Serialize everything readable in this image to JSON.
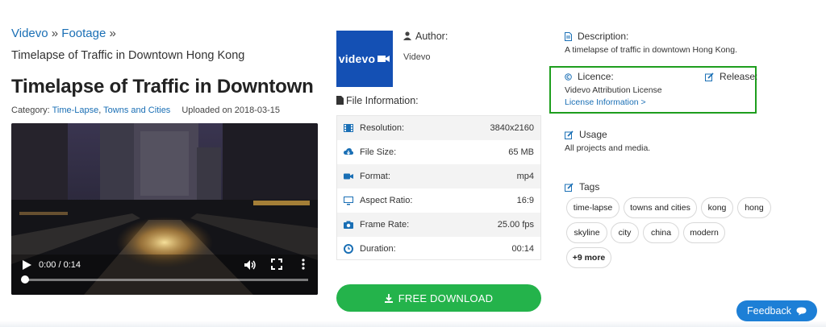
{
  "breadcrumb": {
    "home": "Videvo",
    "sep1": " » ",
    "section": "Footage",
    "sep2": " »"
  },
  "page": {
    "subtitle": "Timelapse of Traffic in Downtown Hong Kong",
    "title": "Timelapse of Traffic in Downtown",
    "category_label": "Category: ",
    "category_1": "Time-Lapse",
    "category_sep": ", ",
    "category_2": "Towns and Cities",
    "uploaded": "Uploaded on 2018-03-15"
  },
  "video": {
    "time": "0:00 / 0:14",
    "progress": 0
  },
  "author": {
    "logo_text": "videvo",
    "label": "Author:",
    "name": "Videvo"
  },
  "file_info": {
    "heading": "File Information:",
    "rows": [
      {
        "icon": "film-icon",
        "label": "Resolution:",
        "value": "3840x2160"
      },
      {
        "icon": "cloud-download-icon",
        "label": "File Size:",
        "value": "65 MB"
      },
      {
        "icon": "video-camera-icon",
        "label": "Format:",
        "value": "mp4"
      },
      {
        "icon": "monitor-icon",
        "label": "Aspect Ratio:",
        "value": "16:9"
      },
      {
        "icon": "camera-icon",
        "label": "Frame Rate:",
        "value": "25.00 fps"
      },
      {
        "icon": "clock-icon",
        "label": "Duration:",
        "value": "00:14"
      }
    ]
  },
  "download": {
    "label": "FREE DOWNLOAD"
  },
  "description": {
    "heading": "Description:",
    "text": "A timelapse of traffic in downtown Hong Kong."
  },
  "licence": {
    "heading": "Licence:",
    "text": "Videvo Attribution License",
    "link": "License Information >",
    "release": "Release:"
  },
  "usage": {
    "heading": "Usage",
    "text": "All projects and media."
  },
  "tags": {
    "heading": "Tags",
    "items": [
      "time-lapse",
      "towns and cities",
      "kong",
      "hong",
      "skyline",
      "city",
      "china",
      "modern"
    ],
    "more": "+9 more"
  },
  "feedback": {
    "label": "Feedback"
  },
  "colors": {
    "link": "#1a6fb5",
    "download": "#24b34b",
    "logo": "#1450b4",
    "highlight": "#1e9e1e",
    "feedback": "#1d7fd6"
  }
}
